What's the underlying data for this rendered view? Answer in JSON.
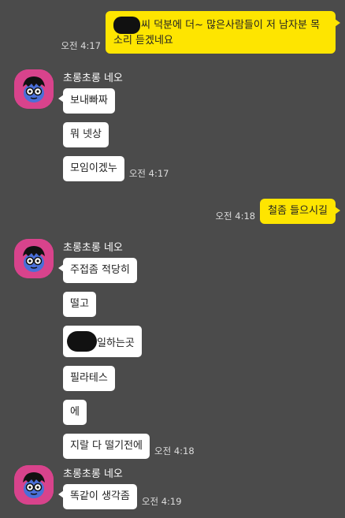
{
  "me": {
    "m1": {
      "text": "씨 덕분에 더~ 많은사람들이 저 남자분 목소리 듣겠네요",
      "time": "오전 4:17"
    },
    "m2": {
      "text": "철좀 들으시길",
      "time": "오전 4:18"
    }
  },
  "g1": {
    "sender": "초롱초롱 네오",
    "msgs": [
      "보내빠짜",
      "뭐 넷상",
      "모임이겠누"
    ],
    "time": "오전 4:17"
  },
  "g2": {
    "sender": "초롱초롱 네오",
    "msgs": [
      "주접좀 적당히",
      "떨고",
      "일하는곳",
      "필라테스",
      "에",
      "지랄 다 떨기전에"
    ],
    "time": "오전 4:18"
  },
  "g3": {
    "sender": "초롱초롱 네오",
    "msgs": [
      "똑같이 생각좀"
    ],
    "time": "오전 4:19"
  },
  "colors": {
    "background": "#4b4b4b",
    "my_bubble": "#fee500",
    "their_bubble": "#ffffff",
    "avatar": "#d8438c"
  },
  "icons": {
    "avatar": "neo-character-avatar",
    "redaction": "black-scribble-redaction"
  }
}
